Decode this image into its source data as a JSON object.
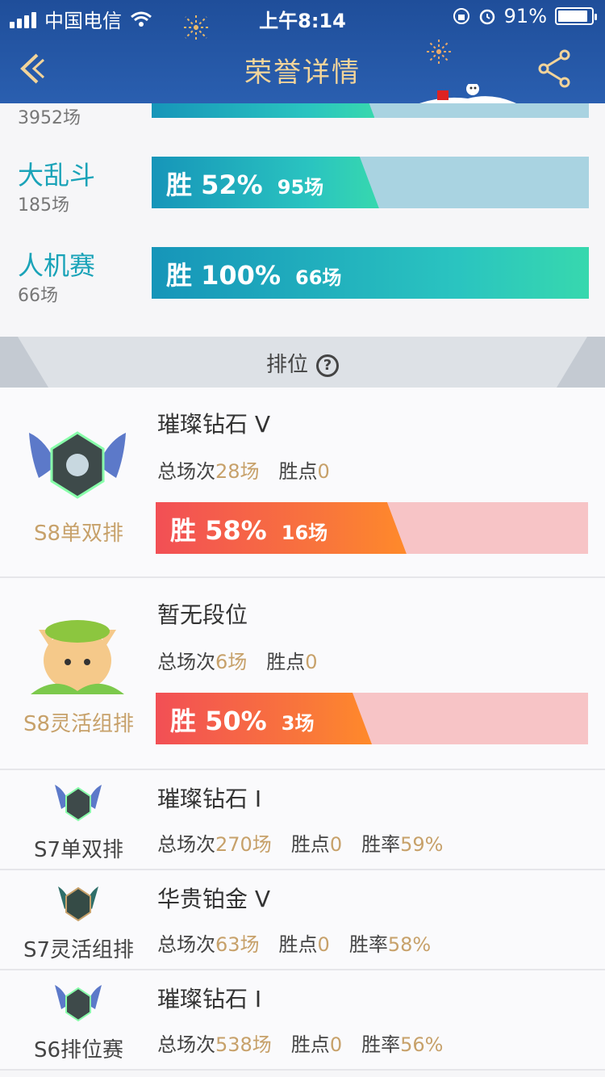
{
  "status": {
    "carrier": "中国电信",
    "time": "上午8:14",
    "battery": "91%"
  },
  "nav": {
    "title": "荣誉详情"
  },
  "top_partial": {
    "count": "3952场"
  },
  "modes": [
    {
      "name": "大乱斗",
      "count": "185场",
      "win_pct": "胜 52%",
      "win_games": "95场",
      "fill": 0.52
    },
    {
      "name": "人机赛",
      "count": "66场",
      "win_pct": "胜 100%",
      "win_games": "66场",
      "fill": 1.0
    }
  ],
  "ranked_section": {
    "title": "排位"
  },
  "ranked": [
    {
      "season": "S8单双排",
      "tier": "璀璨钻石 V",
      "total_label": "总场次",
      "total": "28场",
      "points_label": "胜点",
      "points": "0",
      "win_pct": "胜 58%",
      "win_games": "16场",
      "fill": 0.58
    },
    {
      "season": "S8灵活组排",
      "tier": "暂无段位",
      "total_label": "总场次",
      "total": "6场",
      "points_label": "胜点",
      "points": "0",
      "win_pct": "胜 50%",
      "win_games": "3场",
      "fill": 0.5
    }
  ],
  "history": [
    {
      "season": "S7单双排",
      "tier": "璀璨钻石 I",
      "total_label": "总场次",
      "total": "270场",
      "points_label": "胜点",
      "points": "0",
      "rate_label": "胜率",
      "rate": "59%"
    },
    {
      "season": "S7灵活组排",
      "tier": "华贵铂金 V",
      "total_label": "总场次",
      "total": "63场",
      "points_label": "胜点",
      "points": "0",
      "rate_label": "胜率",
      "rate": "58%"
    },
    {
      "season": "S6排位赛",
      "tier": "璀璨钻石 I",
      "total_label": "总场次",
      "total": "538场",
      "points_label": "胜点",
      "points": "0",
      "rate_label": "胜率",
      "rate": "56%"
    }
  ],
  "colors": {
    "accent_gold": "#c7a16a",
    "teal": "#1aa3b8",
    "header": "#2a5fb0",
    "win_red": "#f24f55"
  }
}
